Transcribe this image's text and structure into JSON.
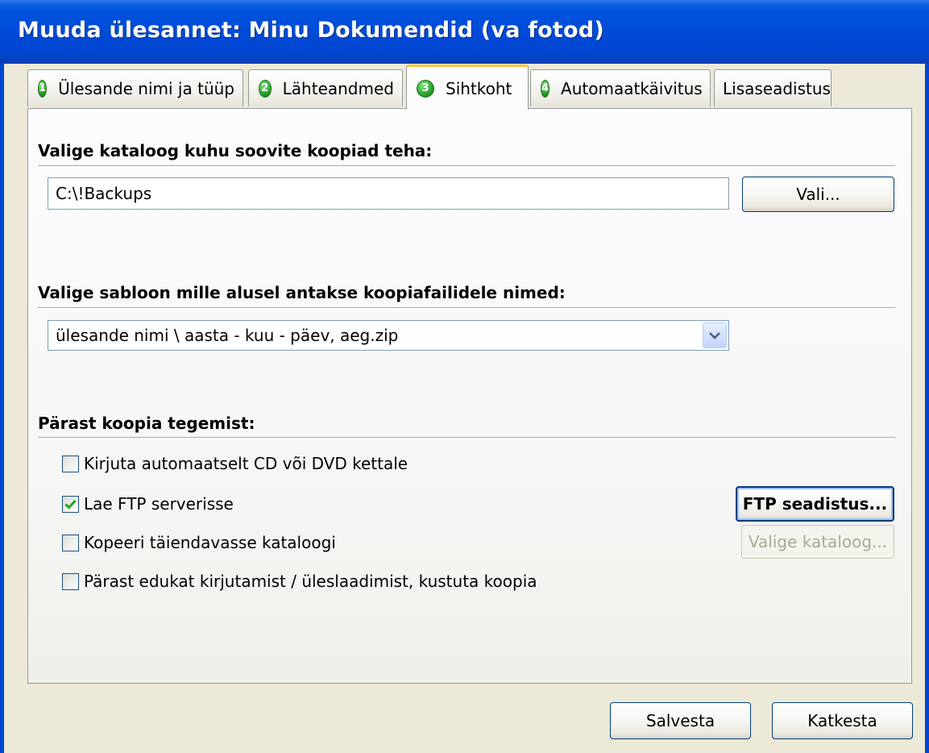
{
  "window": {
    "title": "Muuda ülesannet: Minu Dokumendid (va fotod)"
  },
  "tabs": [
    {
      "number": "1",
      "label": "Ülesande nimi ja tüüp",
      "active": false
    },
    {
      "number": "2",
      "label": "Lähteandmed",
      "active": false
    },
    {
      "number": "3",
      "label": "Sihtkoht",
      "active": true
    },
    {
      "number": "4",
      "label": "Automaatkäivitus",
      "active": false
    },
    {
      "number": "",
      "label": "Lisaseadistus",
      "active": false
    }
  ],
  "destination": {
    "heading": "Valige kataloog kuhu soovite koopiad teha:",
    "path_value": "C:\\!Backups",
    "browse_label": "Vali..."
  },
  "naming": {
    "heading": "Valige sabloon mille alusel antakse koopiafailidele nimed:",
    "selected": "ülesande nimi \\ aasta - kuu - päev, aeg.zip"
  },
  "after": {
    "heading": "Pärast koopia tegemist:",
    "options": [
      {
        "label": "Kirjuta automaatselt CD või DVD kettale",
        "checked": false
      },
      {
        "label": "Lae FTP serverisse",
        "checked": true
      },
      {
        "label": "Kopeeri täiendavasse kataloogi",
        "checked": false
      },
      {
        "label": "Pärast edukat kirjutamist / üleslaadimist, kustuta koopia",
        "checked": false
      }
    ],
    "ftp_settings_label": "FTP seadistus...",
    "choose_folder_label": "Valige kataloog..."
  },
  "footer": {
    "save_label": "Salvesta",
    "cancel_label": "Katkesta"
  },
  "colors": {
    "title_bar": "#0049d6",
    "dialog_bg": "#ece9d8",
    "active_tab_highlight": "#ffc73c",
    "tab_number_badge": "#2aa22a",
    "check_mark": "#21a121"
  }
}
